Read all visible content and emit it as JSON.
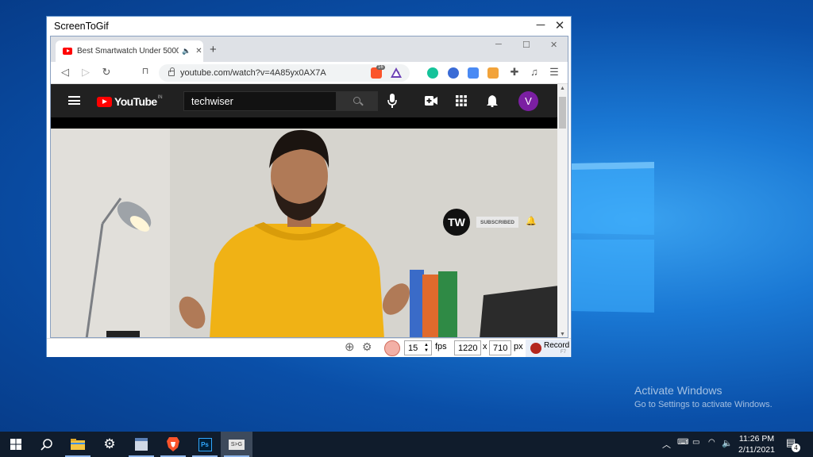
{
  "screentogif": {
    "title": "ScreenToGif",
    "fps_value": "15",
    "fps_label": "fps",
    "width_value": "1220",
    "times_label": "x",
    "height_value": "710",
    "px_label": "px",
    "record_label": "Record",
    "record_shortcut": "F7"
  },
  "browser": {
    "tab_title": "Best Smartwatch Under 5000",
    "new_tab_label": "+",
    "url": "youtube.com/watch?v=4A85yx0AX7A",
    "brave_badge": "16"
  },
  "youtube": {
    "logo_text": "YouTube",
    "country_code": "IN",
    "search_value": "techwiser",
    "avatar_letter": "V",
    "watermark_logo": "TW",
    "subscribed_label": "SUBSCRIBED"
  },
  "desktop": {
    "activate_title": "Activate Windows",
    "activate_subtitle": "Go to Settings to activate Windows."
  },
  "taskbar": {
    "time": "11:26 PM",
    "date": "2/11/2021",
    "notification_count": "4"
  },
  "colors": {
    "youtube_red": "#ff0000",
    "record_red": "#b3261e",
    "avatar_purple": "#7b1fa2",
    "desktop_blue": "#0a4fa8"
  }
}
